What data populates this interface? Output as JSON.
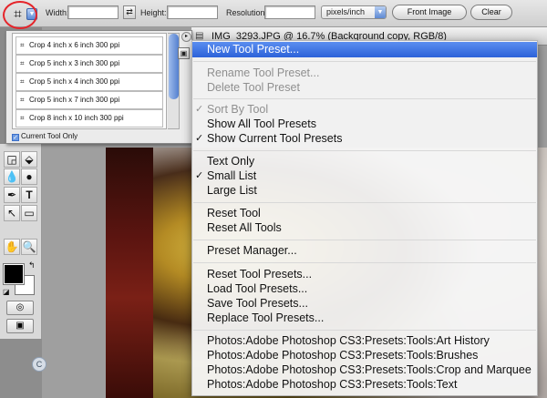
{
  "options_bar": {
    "width_label": "Width:",
    "height_label": "Height:",
    "resolution_label": "Resolution:",
    "units_value": "pixels/inch",
    "front_image_label": "Front Image",
    "clear_label": "Clear",
    "arrow_glyph": "▼",
    "swap_glyph": "⇄",
    "crop_glyph": "⌗"
  },
  "presets_panel": {
    "items": [
      "Crop 4 inch x 6 inch 300 ppi",
      "Crop 5 inch x 3 inch 300 ppi",
      "Crop 5 inch x 4 inch 300 ppi",
      "Crop 5 inch x 7 inch 300 ppi",
      "Crop 8 inch x 10 inch 300 ppi"
    ],
    "current_tool_only_label": "Current Tool Only",
    "current_tool_only_checked": true,
    "menu_glyph": "▸"
  },
  "document": {
    "title": "IMG_3293.JPG @ 16.7% (Background copy, RGB/8)"
  },
  "toolbox": {
    "tools": [
      "◲",
      "⬙",
      "💧",
      "●",
      "✒",
      "T",
      "↖",
      "▭",
      "✋",
      "🔍"
    ],
    "quick_mask_glyph": "◎",
    "screen_mode_glyph": "▣",
    "swap_colors_glyph": "↰",
    "default_colors_glyph": "◪"
  },
  "context_menu": {
    "check_glyph": "✓",
    "items": [
      {
        "label": "New Tool Preset...",
        "state": "highlighted"
      },
      {
        "label": "Rename Tool Preset...",
        "state": "disabled"
      },
      {
        "label": "Delete Tool Preset",
        "state": "disabled"
      },
      {
        "label": "Sort By Tool",
        "state": "disabled",
        "checked": true
      },
      {
        "label": "Show All Tool Presets",
        "state": "enabled"
      },
      {
        "label": "Show Current Tool Presets",
        "state": "enabled",
        "checked": true
      },
      {
        "label": "Text Only",
        "state": "enabled"
      },
      {
        "label": "Small List",
        "state": "enabled",
        "checked": true
      },
      {
        "label": "Large List",
        "state": "enabled"
      },
      {
        "label": "Reset Tool",
        "state": "enabled"
      },
      {
        "label": "Reset All Tools",
        "state": "enabled"
      },
      {
        "label": "Preset Manager...",
        "state": "enabled"
      },
      {
        "label": "Reset Tool Presets...",
        "state": "enabled"
      },
      {
        "label": "Load Tool Presets...",
        "state": "enabled"
      },
      {
        "label": "Save Tool Presets...",
        "state": "enabled"
      },
      {
        "label": "Replace Tool Presets...",
        "state": "enabled"
      },
      {
        "label": "Photos:Adobe Photoshop CS3:Presets:Tools:Art History",
        "state": "enabled"
      },
      {
        "label": "Photos:Adobe Photoshop CS3:Presets:Tools:Brushes",
        "state": "enabled"
      },
      {
        "label": "Photos:Adobe Photoshop CS3:Presets:Tools:Crop and Marquee",
        "state": "enabled"
      },
      {
        "label": "Photos:Adobe Photoshop CS3:Presets:Tools:Text",
        "state": "enabled"
      }
    ]
  },
  "colors": {
    "highlight": "#2c62d9",
    "annotation_circle": "#e5242a",
    "foreground_color": "#000000",
    "background_color": "#ffffff"
  }
}
